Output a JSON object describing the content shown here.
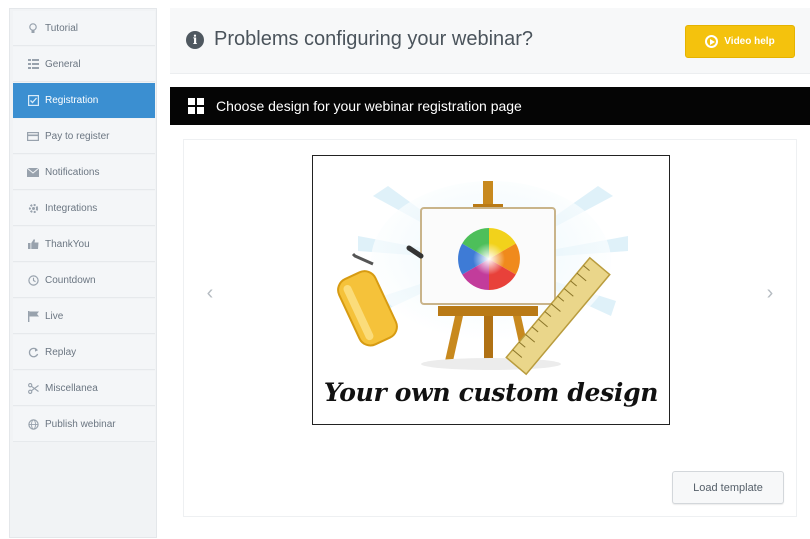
{
  "sidebar": {
    "items": [
      {
        "label": "Tutorial",
        "icon": "lightbulb-icon",
        "active": false
      },
      {
        "label": "General",
        "icon": "grid-icon",
        "active": false
      },
      {
        "label": "Registration",
        "icon": "checkbox-icon",
        "active": true
      },
      {
        "label": "Pay to register",
        "icon": "card-icon",
        "active": false
      },
      {
        "label": "Notifications",
        "icon": "envelope-icon",
        "active": false
      },
      {
        "label": "Integrations",
        "icon": "gear-icon",
        "active": false
      },
      {
        "label": "ThankYou",
        "icon": "thumbs-up-icon",
        "active": false
      },
      {
        "label": "Countdown",
        "icon": "clock-icon",
        "active": false
      },
      {
        "label": "Live",
        "icon": "flag-icon",
        "active": false
      },
      {
        "label": "Replay",
        "icon": "replay-icon",
        "active": false
      },
      {
        "label": "Miscellanea",
        "icon": "scissors-icon",
        "active": false
      },
      {
        "label": "Publish webinar",
        "icon": "globe-icon",
        "active": false
      }
    ]
  },
  "header": {
    "title": "Problems configuring your webinar?",
    "video_help_label": "Video help"
  },
  "section": {
    "title": "Choose design for your webinar registration page"
  },
  "template": {
    "caption": "Your own custom design",
    "load_label": "Load template"
  },
  "colors": {
    "accent": "#3b8fd1",
    "warning": "#f4c20d",
    "bar": "#050505"
  }
}
